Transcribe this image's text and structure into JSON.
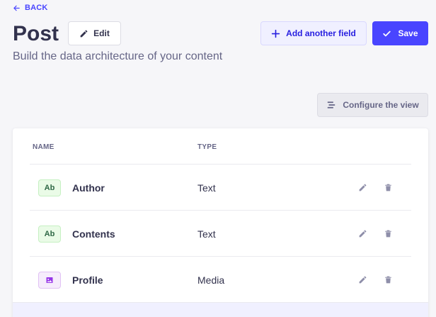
{
  "header": {
    "back_label": "BACK",
    "title": "Post",
    "edit_label": "Edit",
    "add_field_label": "Add another field",
    "save_label": "Save",
    "subtitle": "Build the data architecture of your content"
  },
  "toolbar": {
    "configure_label": "Configure the view"
  },
  "table": {
    "columns": [
      "NAME",
      "TYPE"
    ],
    "rows": [
      {
        "badge": "Ab",
        "badge_kind": "text",
        "name": "Author",
        "type": "Text"
      },
      {
        "badge": "Ab",
        "badge_kind": "text",
        "name": "Contents",
        "type": "Text"
      },
      {
        "badge": "media-icon",
        "badge_kind": "media",
        "name": "Profile",
        "type": "Media"
      }
    ]
  },
  "colors": {
    "primary": "#4945ff",
    "text_badge_bg": "#eafbe7",
    "media_badge_bg": "#f6ecfc"
  },
  "icons": [
    "arrow-left-icon",
    "pencil-icon",
    "plus-icon",
    "check-icon",
    "layout-icon",
    "media-icon",
    "trash-icon"
  ]
}
